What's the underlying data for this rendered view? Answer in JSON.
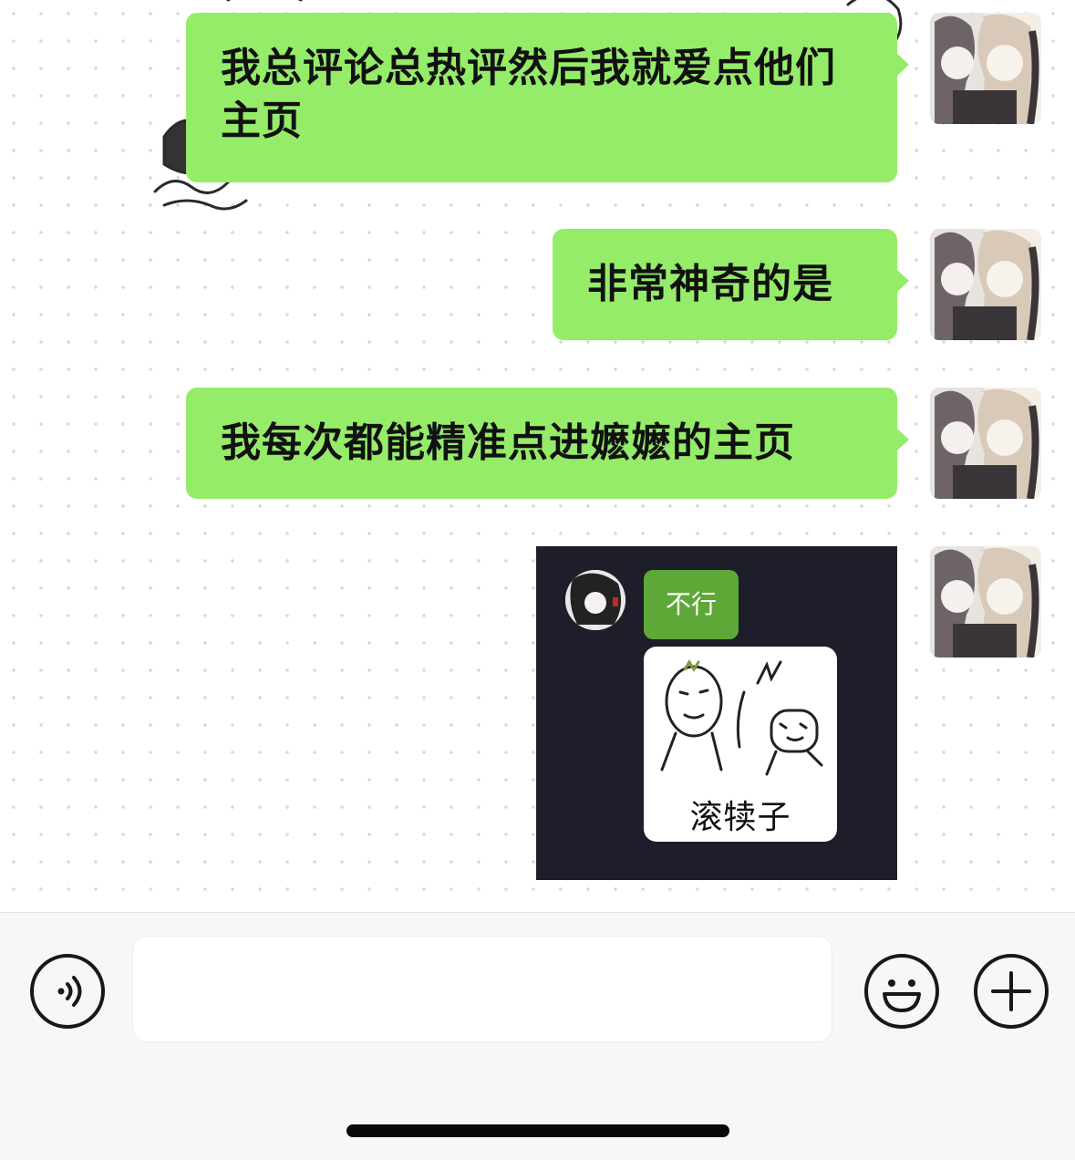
{
  "chat": {
    "messages": [
      {
        "sender": "self",
        "type": "text",
        "text": "我总评论总热评然后我就爱点他们主页"
      },
      {
        "sender": "self",
        "type": "text",
        "text": "非常神奇的是"
      },
      {
        "sender": "self",
        "type": "text",
        "text": "我每次都能精准点进嬷嬷的主页"
      },
      {
        "sender": "self",
        "type": "sticker",
        "bubble_text": "不行",
        "caption": "滚犊子"
      }
    ]
  },
  "input_bar": {
    "value": "",
    "voice_icon": "voice-icon",
    "emoji_icon": "emoji-icon",
    "plus_icon": "plus-icon"
  },
  "colors": {
    "bubble_green": "#95ec69",
    "sticker_bg": "#1e1d2a",
    "sticker_bubble": "#5ea838"
  }
}
